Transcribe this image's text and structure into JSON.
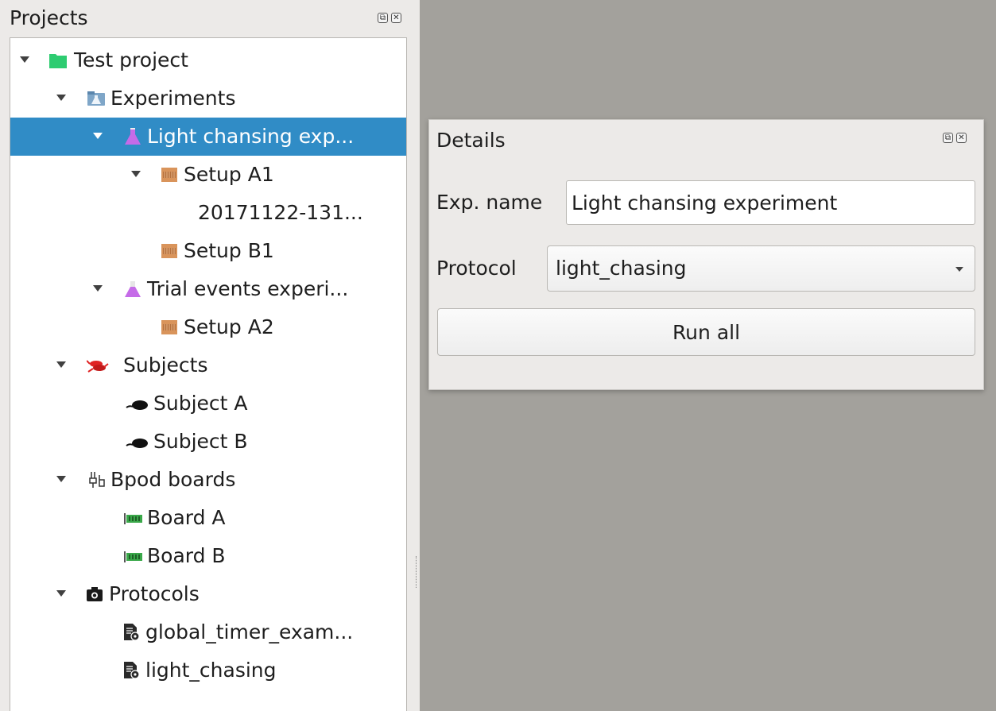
{
  "projects_panel": {
    "title": "Projects",
    "float_icon": "float-icon",
    "close_icon": "close-icon"
  },
  "tree": {
    "test_project": "Test project",
    "experiments": "Experiments",
    "exp_light": "Light chansing exp...",
    "setup_a1": "Setup A1",
    "session_a1": "20171122-131...",
    "setup_b1": "Setup B1",
    "exp_trial": "Trial events experi...",
    "setup_a2": "Setup A2",
    "subjects": "Subjects",
    "subject_a": "Subject A",
    "subject_b": "Subject B",
    "bpod_boards": "Bpod boards",
    "board_a": "Board A",
    "board_b": "Board B",
    "protocols": "Protocols",
    "protocol_global": "global_timer_exam...",
    "protocol_light": "light_chasing"
  },
  "details": {
    "title": "Details",
    "exp_name_label": "Exp. name",
    "exp_name_value": "Light chansing experiment",
    "protocol_label": "Protocol",
    "protocol_value": "light_chasing",
    "run_all_label": "Run all"
  },
  "colors": {
    "selection": "#308cc6",
    "background": "#a3a19c",
    "panel": "#eceae8"
  }
}
